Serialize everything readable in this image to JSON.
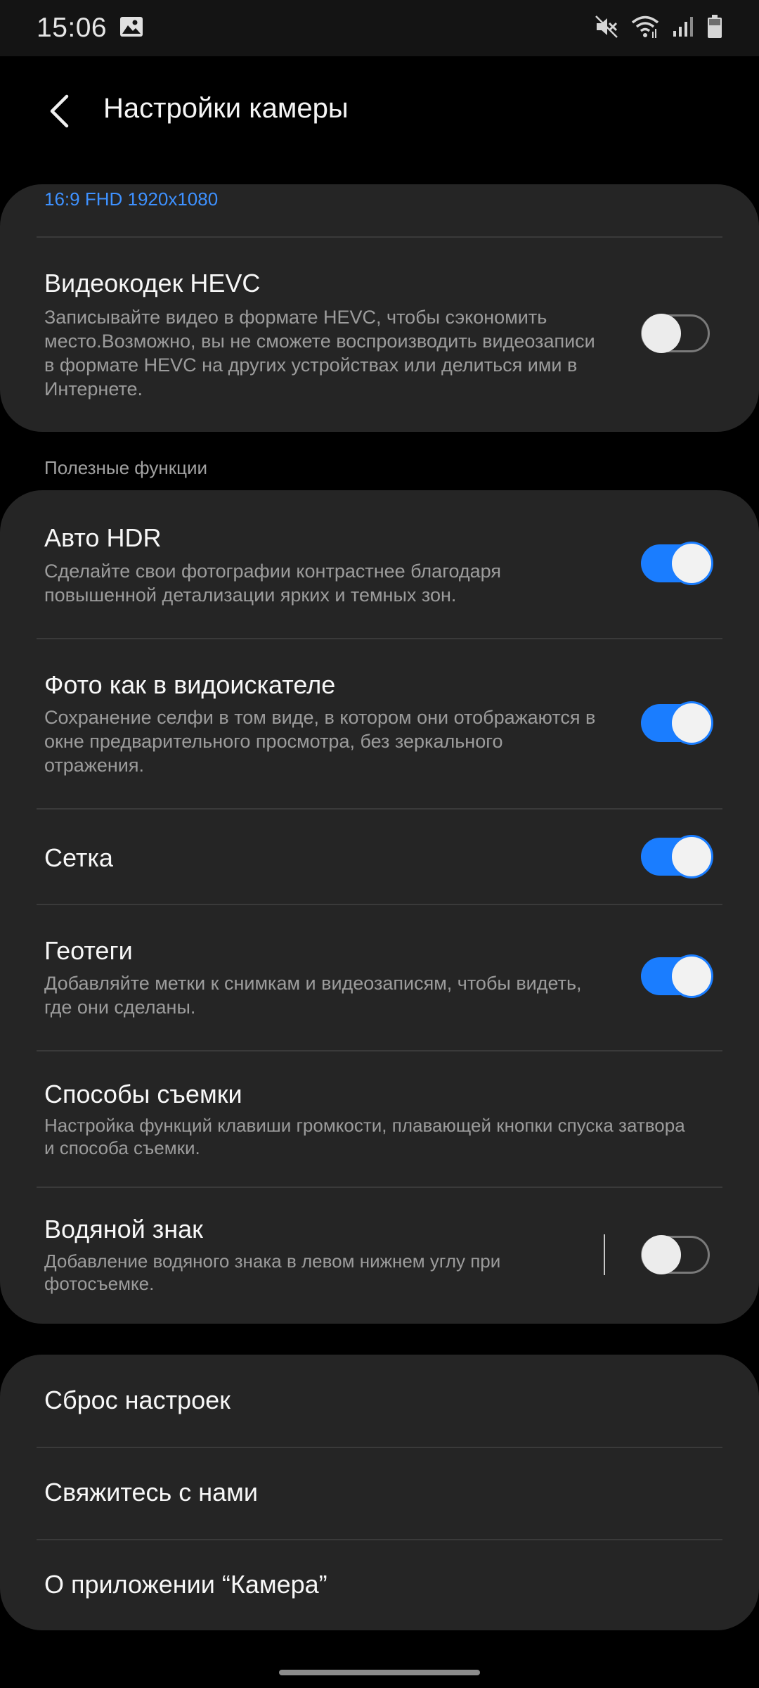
{
  "status_bar": {
    "time": "15:06",
    "icons": [
      "gallery-icon",
      "mute-icon",
      "wifi-icon",
      "signal-icon",
      "battery-icon"
    ]
  },
  "header": {
    "title": "Настройки камеры",
    "back_icon": "back-arrow-icon"
  },
  "video_card": {
    "resolution_value": "16:9 FHD 1920x1080",
    "hevc": {
      "title": "Видеокодек HEVC",
      "description": "Записывайте видео в формате HEVC, чтобы сэкономить место.Возможно, вы не сможете воспроизводить видеозаписи в формате HEVC на других устройствах или делиться ими в Интернете.",
      "enabled": false
    }
  },
  "features": {
    "section_label": "Полезные функции",
    "items": [
      {
        "title": "Авто HDR",
        "description": "Сделайте свои фотографии контрастнее благодаря повышенной детализации ярких и темных зон.",
        "enabled": true
      },
      {
        "title": "Фото как в видоискателе",
        "description": "Сохранение селфи в том виде, в котором они отображаются в окне предварительного просмотра, без зеркального отражения.",
        "enabled": true
      },
      {
        "title": "Сетка",
        "description": "",
        "enabled": true
      },
      {
        "title": "Геотеги",
        "description": "Добавляйте метки к снимкам и видеозаписям, чтобы видеть, где они сделаны.",
        "enabled": true
      },
      {
        "title": "Способы съемки",
        "description": "Настройка функций клавиши громкости, плавающей кнопки спуска затвора и способа съемки."
      },
      {
        "title": "Водяной знак",
        "description": "Добавление водяного знака в левом нижнем углу при фотосъемке.",
        "enabled": false
      }
    ]
  },
  "bottom_menu": {
    "items": [
      {
        "label": "Сброс настроек"
      },
      {
        "label": "Свяжитесь с нами"
      },
      {
        "label": "О приложении “Камера”"
      }
    ]
  },
  "colors": {
    "accent": "#1a7dff",
    "link": "#3e91ff",
    "card_bg": "#252525",
    "page_bg": "#000000"
  }
}
